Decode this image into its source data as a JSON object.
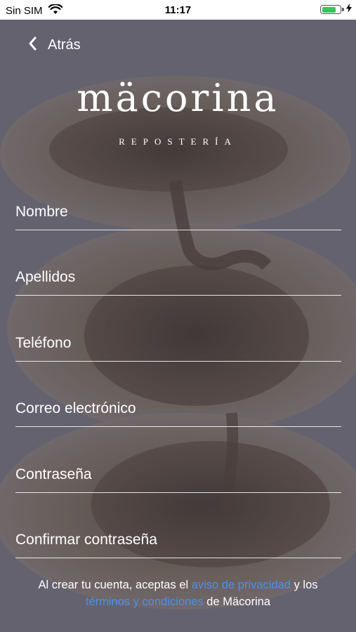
{
  "status_bar": {
    "carrier": "Sin SIM",
    "time": "11:17",
    "battery_level": 0.8,
    "battery_color": "#35c759"
  },
  "header": {
    "back_label": "Atrás",
    "brand_name": "mäcorina",
    "brand_subtitle": "REPOSTERÍA"
  },
  "form": {
    "fields": [
      {
        "placeholder": "Nombre",
        "value": ""
      },
      {
        "placeholder": "Apellidos",
        "value": ""
      },
      {
        "placeholder": "Teléfono",
        "value": ""
      },
      {
        "placeholder": "Correo electrónico",
        "value": ""
      },
      {
        "placeholder": "Contraseña",
        "value": ""
      },
      {
        "placeholder": "Confirmar contraseña",
        "value": ""
      }
    ]
  },
  "legal": {
    "prefix": "Al crear tu cuenta, aceptas el",
    "privacy_link": "aviso de privacidad",
    "middle": "y los",
    "terms_link": "términos y condiciones",
    "suffix": "de Mäcorina",
    "link_color": "#4a90f0"
  },
  "icons": [
    "wifi-icon",
    "battery-icon",
    "charging-bolt-icon",
    "back-chevron-icon"
  ]
}
